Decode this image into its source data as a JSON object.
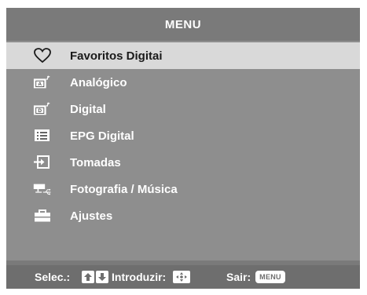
{
  "header": {
    "title": "MENU"
  },
  "menu": {
    "items": [
      {
        "label": "Favoritos Digitai",
        "icon": "heart-icon",
        "selected": true
      },
      {
        "label": "Analógico",
        "icon": "analog-tv-icon",
        "selected": false
      },
      {
        "label": "Digital",
        "icon": "digital-tv-icon",
        "selected": false
      },
      {
        "label": "EPG Digital",
        "icon": "epg-list-icon",
        "selected": false
      },
      {
        "label": "Tomadas",
        "icon": "input-arrow-icon",
        "selected": false
      },
      {
        "label": "Fotografia / Música",
        "icon": "usb-icon",
        "selected": false
      },
      {
        "label": "Ajustes",
        "icon": "toolbox-icon",
        "selected": false
      }
    ]
  },
  "footer": {
    "select_label": "Selec.:",
    "enter_label": "Introduzir:",
    "exit_label": "Sair:",
    "menu_key_label": "MENU"
  },
  "colors": {
    "frame": "#7a7a7a",
    "menu_background": "#8e8e8e",
    "selected_background": "#d9d9d9",
    "footer_background": "#6e6e6e",
    "text": "#ffffff"
  }
}
